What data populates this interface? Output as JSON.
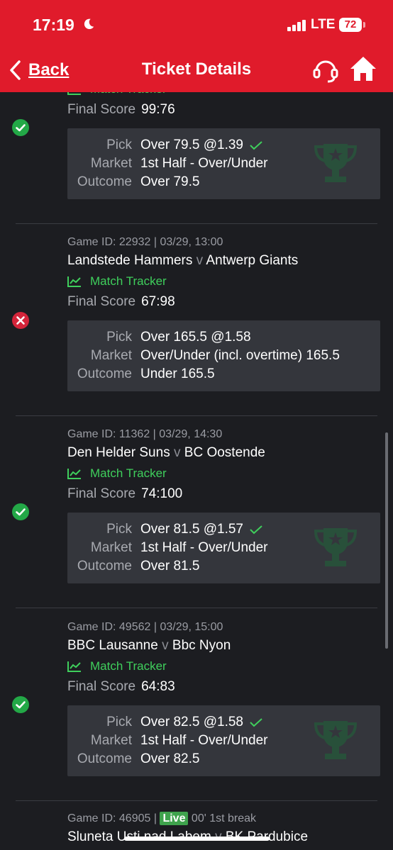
{
  "status_bar": {
    "time": "17:19",
    "network": "LTE",
    "battery": "72"
  },
  "header": {
    "back_label": "Back",
    "title": "Ticket Details"
  },
  "labels": {
    "match_tracker": "Match Tracker",
    "final_score": "Final Score",
    "pick": "Pick",
    "market": "Market",
    "outcome": "Outcome",
    "v": "v"
  },
  "tickets": [
    {
      "status": "won",
      "final_score": "99:76",
      "pick": "Over 79.5 @1.39",
      "market": "1st Half - Over/Under",
      "outcome": "Over 79.5"
    },
    {
      "status": "lost",
      "game_meta": "Game ID: 22932 | 03/29, 13:00",
      "home": "Landstede Hammers",
      "away": "Antwerp Giants",
      "final_score": "67:98",
      "pick": "Over 165.5 @1.58",
      "market": "Over/Under (incl. overtime) 165.5",
      "outcome": "Under 165.5"
    },
    {
      "status": "won",
      "game_meta": "Game ID: 11362 | 03/29, 14:30",
      "home": "Den Helder Suns",
      "away": "BC Oostende",
      "final_score": "74:100",
      "pick": "Over 81.5 @1.57",
      "market": "1st Half - Over/Under",
      "outcome": "Over 81.5"
    },
    {
      "status": "won",
      "game_meta": "Game ID: 49562 | 03/29, 15:00",
      "home": "BBC Lausanne",
      "away": "Bbc Nyon",
      "final_score": "64:83",
      "pick": "Over 82.5 @1.58",
      "market": "1st Half - Over/Under",
      "outcome": "Over 82.5"
    }
  ],
  "live_ticket": {
    "game_meta_prefix": "Game ID: 46905 |",
    "live_badge": "Live",
    "live_status": "00' 1st break",
    "home": "Sluneta Usti nad Labem",
    "away": "BK Pardubice"
  },
  "colors": {
    "header": "#e01b2b",
    "background": "#1c1d21",
    "card": "#34363c",
    "accent_green": "#3fcf5c",
    "won": "#23a847",
    "lost": "#d4243a"
  }
}
